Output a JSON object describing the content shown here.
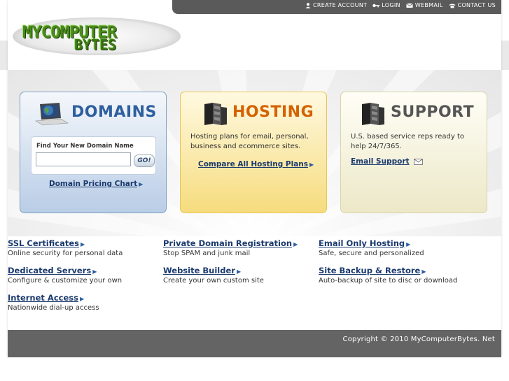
{
  "header": {
    "nav": [
      {
        "label": "CREATE ACCOUNT",
        "icon": "user-icon"
      },
      {
        "label": "LOGIN",
        "icon": "key-icon"
      },
      {
        "label": "WEBMAIL",
        "icon": "envelope-icon"
      },
      {
        "label": "CONTACT US",
        "icon": "phone-icon"
      }
    ],
    "logo": {
      "line1": "MYCOMPUTER",
      "line2": "BYTES"
    }
  },
  "cards": {
    "domains": {
      "title": "DOMAINS",
      "search_label": "Find Your New Domain Name",
      "search_value": "",
      "go_label": "GO!",
      "link": "Domain Pricing Chart"
    },
    "hosting": {
      "title": "HOSTING",
      "description": "Hosting plans for email, personal, business and ecommerce sites.",
      "link": "Compare All Hosting Plans"
    },
    "support": {
      "title": "SUPPORT",
      "description": "U.S. based service reps ready to help 24/7/365.",
      "link": "Email Support"
    }
  },
  "links": [
    {
      "title": "SSL Certificates",
      "desc": "Online security for personal data"
    },
    {
      "title": "Private Domain Registration",
      "desc": "Stop SPAM and junk mail"
    },
    {
      "title": "Email Only Hosting",
      "desc": "Safe, secure and personalized"
    },
    {
      "title": "Dedicated Servers",
      "desc": "Configure & customize your own"
    },
    {
      "title": "Website Builder",
      "desc": "Create your own custom site"
    },
    {
      "title": "Site Backup & Restore",
      "desc": "Auto-backup of site to disc or download"
    },
    {
      "title": "Internet Access",
      "desc": "Nationwide dial-up access"
    }
  ],
  "footer": {
    "copyright": "Copyright © 2010 MyComputerBytes. Net"
  },
  "colors": {
    "link": "#1b3a6e",
    "domains_accent": "#2e5f9e",
    "hosting_accent": "#d46200",
    "support_accent": "#555555",
    "bar": "#5a5a5a"
  }
}
